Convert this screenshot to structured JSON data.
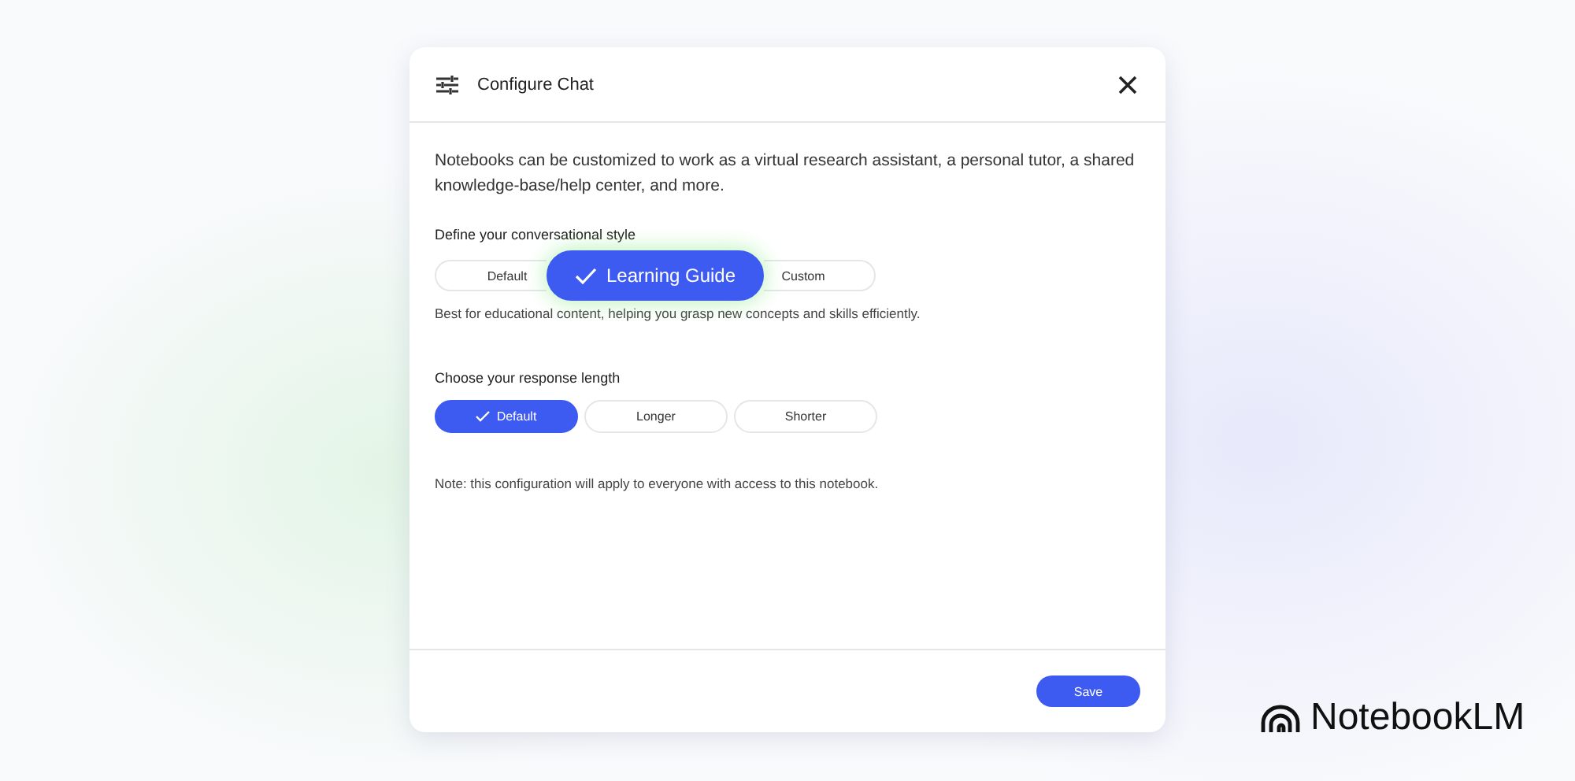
{
  "dialog": {
    "title": "Configure Chat",
    "intro": "Notebooks can be customized to work as a virtual research assistant, a personal tutor, a shared knowledge-base/help center, and more.",
    "style_section": {
      "label": "Define your conversational style",
      "options": [
        {
          "label": "Default",
          "selected": false
        },
        {
          "label": "Learning Guide",
          "selected": true
        },
        {
          "label": "Custom",
          "selected": false
        }
      ],
      "description": "Best for educational content, helping you grasp new concepts and skills efficiently."
    },
    "length_section": {
      "label": "Choose your response length",
      "options": [
        {
          "label": "Default",
          "selected": true
        },
        {
          "label": "Longer",
          "selected": false
        },
        {
          "label": "Shorter",
          "selected": false
        }
      ]
    },
    "note": "Note: this configuration will apply to everyone with access to this notebook.",
    "save_button": "Save"
  },
  "brand": {
    "name": "NotebookLM"
  }
}
